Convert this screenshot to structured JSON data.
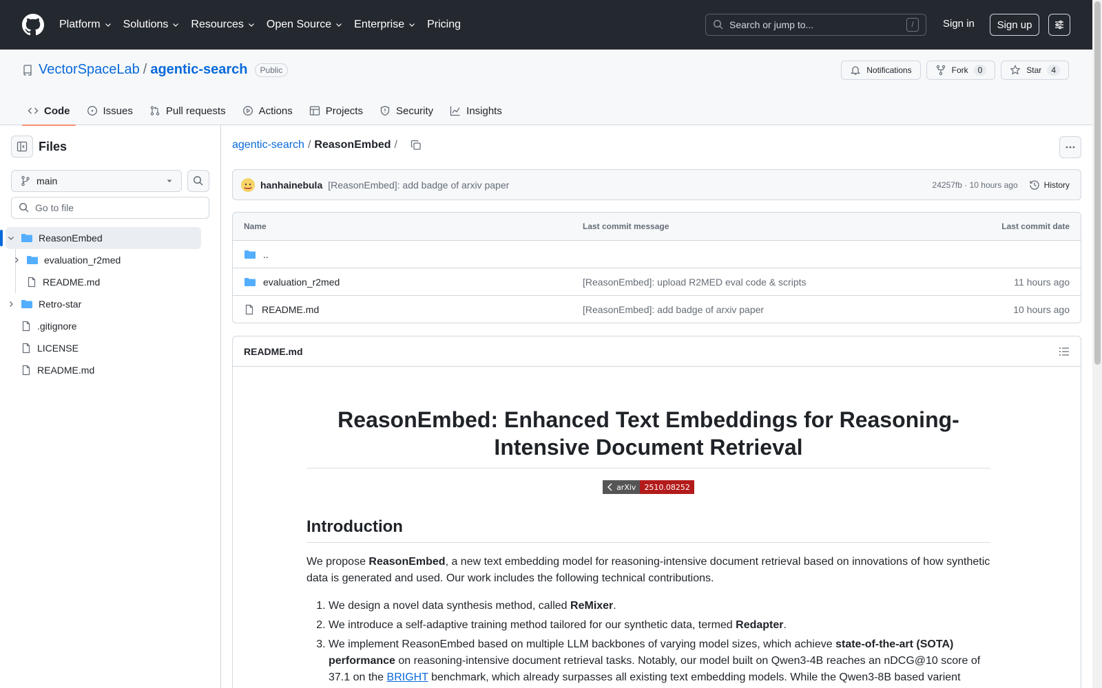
{
  "header": {
    "nav": [
      "Platform",
      "Solutions",
      "Resources",
      "Open Source",
      "Enterprise",
      "Pricing"
    ],
    "search_placeholder": "Search or jump to...",
    "search_key": "/",
    "signin": "Sign in",
    "signup": "Sign up"
  },
  "repo": {
    "owner": "VectorSpaceLab",
    "separator": "/",
    "name": "agentic-search",
    "visibility": "Public",
    "notifications": "Notifications",
    "fork_label": "Fork",
    "fork_count": "0",
    "star_label": "Star",
    "star_count": "4",
    "tabs": [
      "Code",
      "Issues",
      "Pull requests",
      "Actions",
      "Projects",
      "Security",
      "Insights"
    ]
  },
  "sidebar": {
    "title": "Files",
    "branch": "main",
    "goto_placeholder": "Go to file",
    "tree": [
      {
        "label": "ReasonEmbed",
        "type": "folder-open"
      },
      {
        "label": "evaluation_r2med",
        "type": "folder"
      },
      {
        "label": "README.md",
        "type": "file"
      },
      {
        "label": "Retro-star",
        "type": "folder"
      },
      {
        "label": ".gitignore",
        "type": "file"
      },
      {
        "label": "LICENSE",
        "type": "file"
      },
      {
        "label": "README.md",
        "type": "file"
      }
    ]
  },
  "breadcrumb": {
    "root": "agentic-search",
    "sep": "/",
    "current": "ReasonEmbed",
    "trail": "/"
  },
  "commit": {
    "author": "hanhainebula",
    "message": "[ReasonEmbed]: add badge of arxiv paper",
    "meta": "24257fb · 10 hours ago",
    "history": "History"
  },
  "files": {
    "headers": [
      "Name",
      "Last commit message",
      "Last commit date"
    ],
    "rows": [
      {
        "name": "..",
        "type": "folder",
        "message": "",
        "date": ""
      },
      {
        "name": "evaluation_r2med",
        "type": "folder",
        "message": "[ReasonEmbed]: upload R2MED eval code & scripts",
        "date": "11 hours ago"
      },
      {
        "name": "README.md",
        "type": "file",
        "message": "[ReasonEmbed]: add badge of arxiv paper",
        "date": "10 hours ago"
      }
    ]
  },
  "readme": {
    "filename": "README.md",
    "title": "ReasonEmbed: Enhanced Text Embeddings for Reasoning-Intensive Document Retrieval",
    "badge_left": "arXiv",
    "badge_right": "2510.08252",
    "h2": "Introduction",
    "intro_pre": "We propose ",
    "intro_bold": "ReasonEmbed",
    "intro_post": ", a new text embedding model for reasoning-intensive document retrieval based on innovations of how synthetic data is generated and used. Our work includes the following technical contributions.",
    "li1_pre": "We design a novel data synthesis method, called ",
    "li1_bold": "ReMixer",
    "li1_post": ".",
    "li2_pre": "We introduce a self-adaptive training method tailored for our synthetic data, termed ",
    "li2_bold": "Redapter",
    "li2_post": ".",
    "li3_pre": "We implement ReasonEmbed based on multiple LLM backbones of varying model sizes, which achieve ",
    "li3_bold": "state-of-the-art (SOTA) performance",
    "li3_mid": " on reasoning-intensive document retrieval tasks. Notably, our model built on Qwen3-4B reaches an nDCG@10 score of 37.1 on the ",
    "li3_link": "BRIGHT",
    "li3_post": " benchmark, which already surpasses all existing text embedding models. While the Qwen3-8B based varient"
  }
}
